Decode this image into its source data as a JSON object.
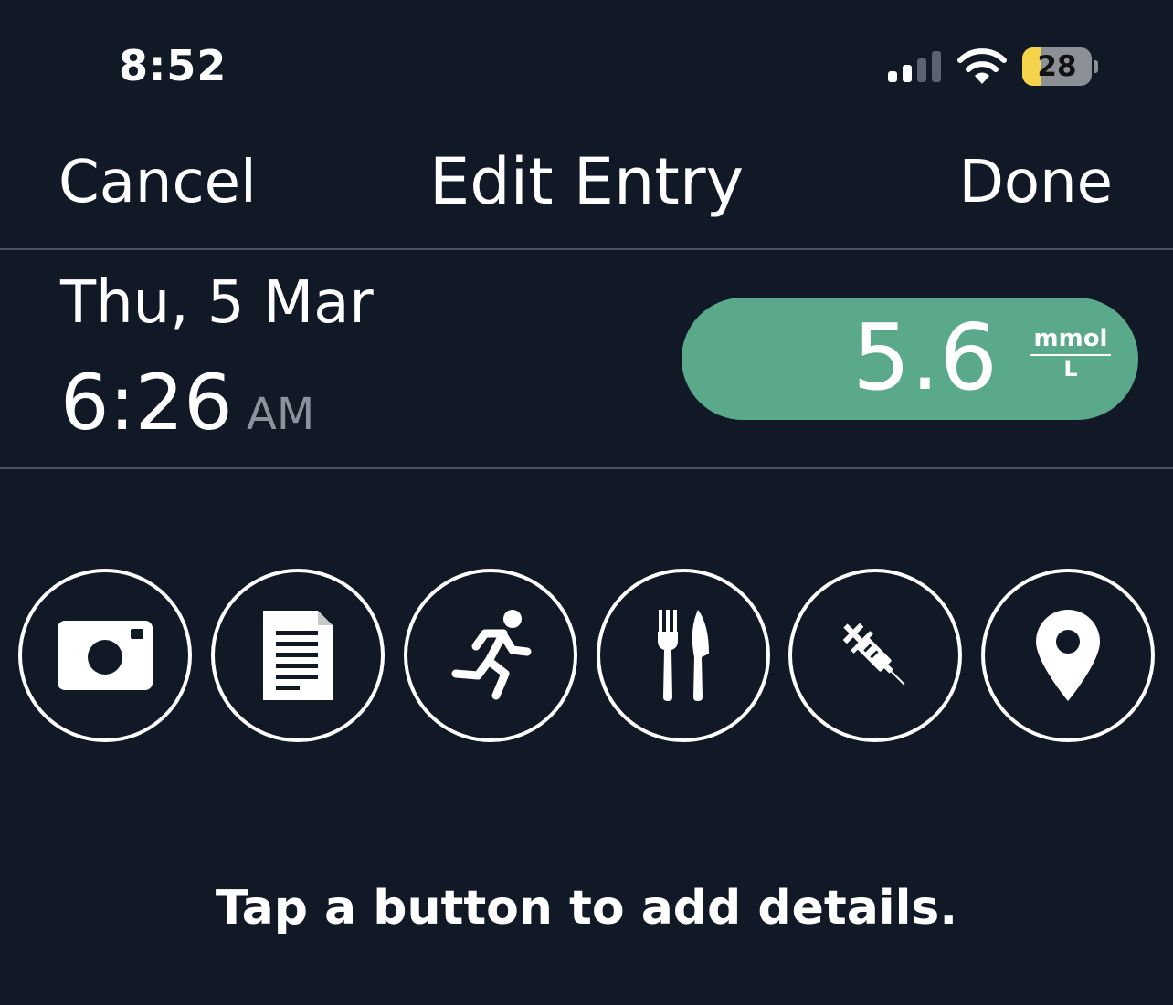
{
  "status_bar": {
    "time": "8:52",
    "battery_level": "28",
    "signal_bars_active": 2,
    "signal_bars_total": 4,
    "icons": [
      "cellular-signal-icon",
      "wifi-icon",
      "battery-icon"
    ]
  },
  "nav": {
    "cancel_label": "Cancel",
    "title": "Edit Entry",
    "done_label": "Done"
  },
  "entry": {
    "date": "Thu, 5 Mar",
    "time": "6:26",
    "ampm": "AM"
  },
  "reading": {
    "value": "5.6",
    "unit_top": "mmol",
    "unit_bottom": "L",
    "color": "#5aa98b"
  },
  "actions": [
    {
      "icon": "camera-icon"
    },
    {
      "icon": "note-icon"
    },
    {
      "icon": "exercise-icon"
    },
    {
      "icon": "food-icon"
    },
    {
      "icon": "insulin-icon"
    },
    {
      "icon": "location-icon"
    }
  ],
  "hint": "Tap a button to add details.",
  "colors": {
    "background": "#111927",
    "accent": "#5aa98b",
    "battery": "#f5d34a",
    "divider": "#4a5160"
  }
}
